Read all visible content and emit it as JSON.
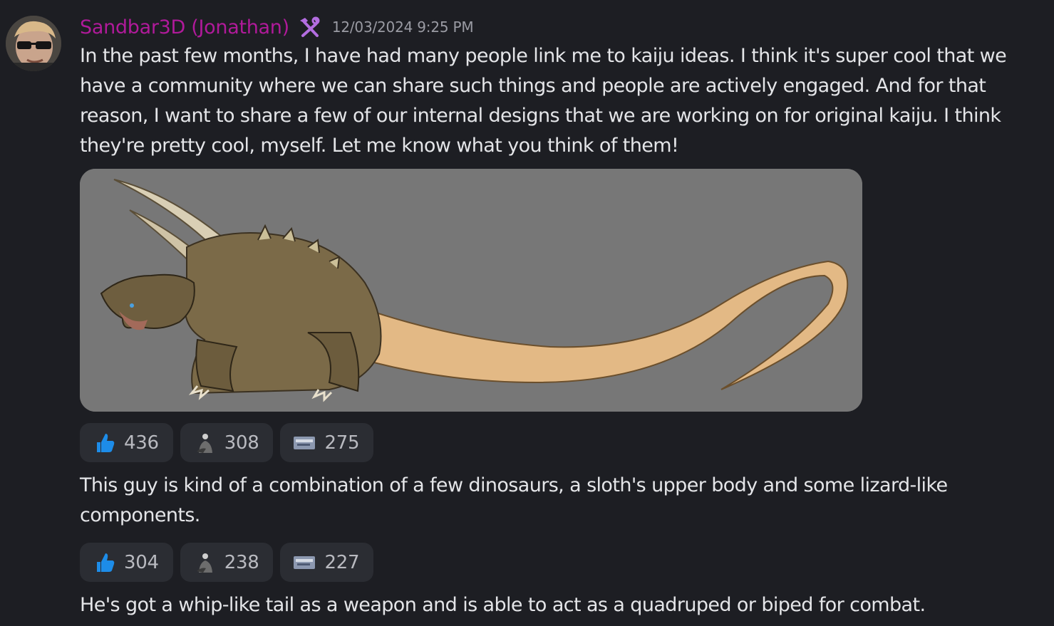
{
  "author": {
    "name": "Sandbar3D (Jonathan)",
    "role_icon": "hammer-wrench-icon",
    "timestamp": "12/03/2024 9:25 PM",
    "name_color": "#b01a9a"
  },
  "messages": [
    {
      "text": "In the past few months, I have had many people link me to kaiju ideas. I think it's super cool that we have a community where we can share such things and people are actively engaged. And for that reason, I want to share a few of our internal designs that we are working on for original kaiju. I think they're pretty cool, myself. Let me know what you think of them!",
      "attachment": "kaiju-concept-art-image",
      "reactions": [
        {
          "emoji": "thumbs-up-icon",
          "count": "436"
        },
        {
          "emoji": "custom-figure-emoji",
          "count": "308"
        },
        {
          "emoji": "custom-card-emoji",
          "count": "275"
        }
      ]
    },
    {
      "text": "This guy is kind of a combination of a few dinosaurs, a sloth's upper body and some lizard-like components.",
      "reactions": [
        {
          "emoji": "thumbs-up-icon",
          "count": "304"
        },
        {
          "emoji": "custom-figure-emoji",
          "count": "238"
        },
        {
          "emoji": "custom-card-emoji",
          "count": "227"
        }
      ]
    },
    {
      "text": "He's got a whip-like tail as a weapon and is able to act as a quadruped or biped for combat."
    }
  ]
}
